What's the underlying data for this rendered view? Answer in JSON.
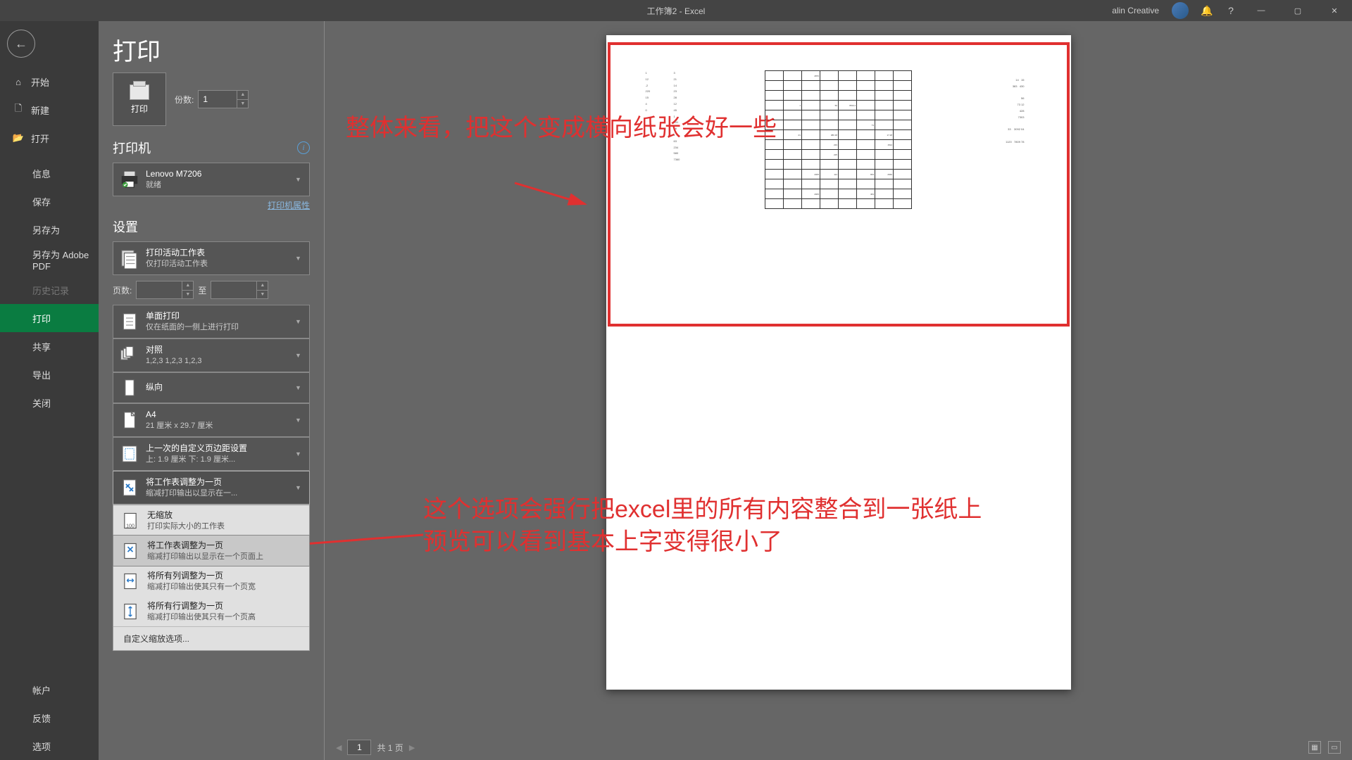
{
  "titlebar": {
    "title": "工作簿2 - Excel",
    "user": "alin Creative",
    "minimize": "—",
    "maximize": "▢",
    "close": "✕"
  },
  "nav": {
    "back": "←",
    "home": "开始",
    "new": "新建",
    "open": "打开",
    "info": "信息",
    "save": "保存",
    "saveas": "另存为",
    "saveas_pdf": "另存为 Adobe PDF",
    "history": "历史记录",
    "print": "打印",
    "share": "共享",
    "export": "导出",
    "close": "关闭",
    "account": "帐户",
    "feedback": "反馈",
    "options": "选项"
  },
  "print": {
    "title": "打印",
    "button": "打印",
    "copies_label": "份数:",
    "copies_value": "1",
    "printer_section": "打印机",
    "printer_name": "Lenovo M7206",
    "printer_status": "就绪",
    "printer_props": "打印机属性",
    "settings_section": "设置",
    "what_title": "打印活动工作表",
    "what_sub": "仅打印活动工作表",
    "pages_label": "页数:",
    "pages_to": "至",
    "sides_title": "单面打印",
    "sides_sub": "仅在纸面的一侧上进行打印",
    "collate_title": "对照",
    "collate_sub": "1,2,3    1,2,3    1,2,3",
    "orient_title": "纵向",
    "paper_title": "A4",
    "paper_sub": "21 厘米 x 29.7 厘米",
    "margins_title": "上一次的自定义页边距设置",
    "margins_sub": "上: 1.9 厘米 下: 1.9 厘米...",
    "scale_title": "将工作表调整为一页",
    "scale_sub": "缩减打印输出以显示在一...",
    "scale_opts": [
      {
        "title": "无缩放",
        "sub": "打印实际大小的工作表"
      },
      {
        "title": "将工作表调整为一页",
        "sub": "缩减打印输出以显示在一个页面上"
      },
      {
        "title": "将所有列调整为一页",
        "sub": "缩减打印输出使其只有一个页宽"
      },
      {
        "title": "将所有行调整为一页",
        "sub": "缩减打印输出使其只有一个页高"
      }
    ],
    "scale_custom": "自定义缩放选项..."
  },
  "footer": {
    "page_current": "1",
    "page_total": "共 1 页"
  },
  "annotations": {
    "top": "整体来看，把这个变成横向纸张会好一些",
    "bottom": "这个选项会强行把excel里的所有内容整合到一张纸上\n预览可以看到基本上字变得很小了"
  }
}
